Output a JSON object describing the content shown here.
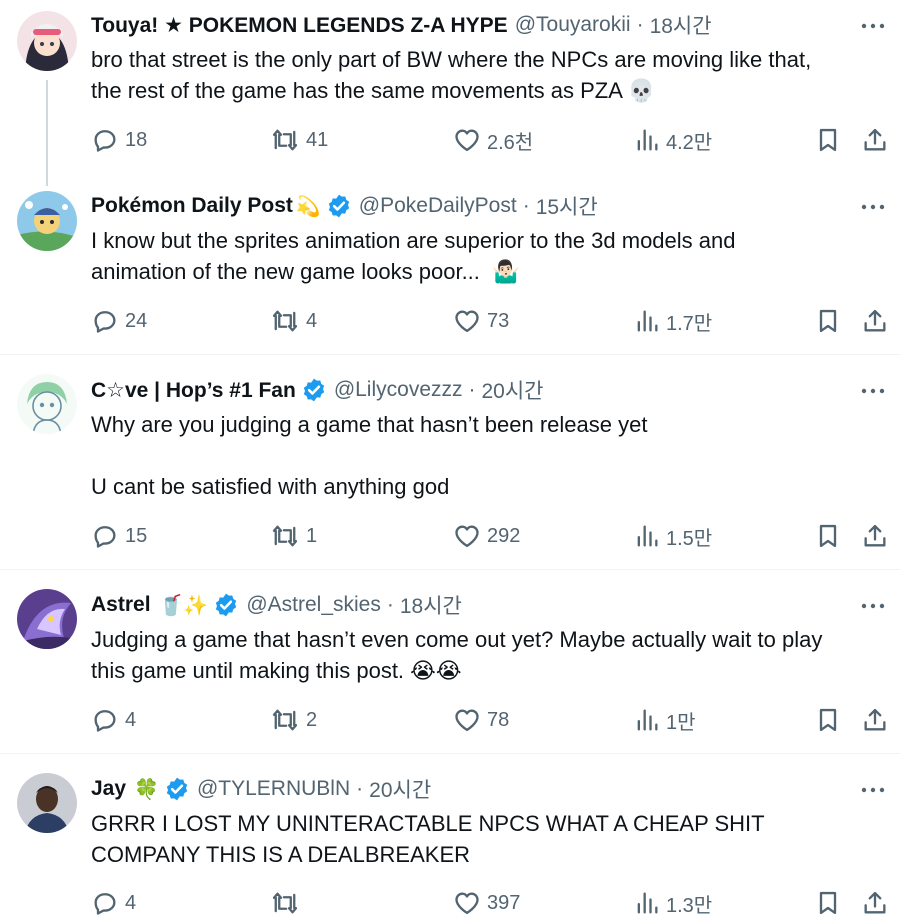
{
  "tweets": [
    {
      "name": "Touya! ★ POKEMON LEGENDS Z-A HYPE",
      "emoji": "",
      "verified": false,
      "handle": "@Touyarokii",
      "time": "18시간",
      "text": "bro that street is the only part of BW where the NPCs are moving like that,\nthe rest of the game has the same movements as PZA 💀",
      "replies": "18",
      "retweets": "41",
      "likes": "2.6천",
      "views": "4.2만"
    },
    {
      "name": "Pokémon Daily Post",
      "emoji": "💫",
      "verified": true,
      "handle": "@PokeDailyPost",
      "time": "15시간",
      "text": "I know but the sprites animation are superior to the 3d models and\nanimation of the new game looks poor...  🤷🏻‍♂️",
      "replies": "24",
      "retweets": "4",
      "likes": "73",
      "views": "1.7만"
    },
    {
      "name": "C☆ve | Hop’s #1 Fan",
      "emoji": "",
      "verified": true,
      "handle": "@Lilycovezzz",
      "time": "20시간",
      "text": "Why are you judging a game that hasn’t been release yet\n\nU cant be satisfied with anything god",
      "replies": "15",
      "retweets": "1",
      "likes": "292",
      "views": "1.5만"
    },
    {
      "name": "Astrel",
      "emoji": "🥤✨",
      "verified": true,
      "handle": "@Astrel_skies",
      "time": "18시간",
      "text": "Judging a game that hasn’t even come out yet? Maybe actually wait to play\nthis game until making this post. 😭😭",
      "replies": "4",
      "retweets": "2",
      "likes": "78",
      "views": "1만"
    },
    {
      "name": "Jay",
      "emoji": "🍀",
      "verified": true,
      "handle": "@TYLERNUBlN",
      "time": "20시간",
      "text": "GRRR I LOST MY UNINTERACTABLE NPCS WHAT A CHEAP SHIT\nCOMPANY THIS IS A DEALBREAKER",
      "replies": "4",
      "retweets": "",
      "likes": "397",
      "views": "1.3만"
    }
  ],
  "separator": "·",
  "colors": {
    "text": "#0f1419",
    "muted": "#536471",
    "verified": "#1d9bf0",
    "divider": "#eff3f4"
  },
  "icons": [
    "reply-icon",
    "retweet-icon",
    "like-icon",
    "views-icon",
    "bookmark-icon",
    "share-icon",
    "more-icon",
    "verified-badge-icon"
  ]
}
